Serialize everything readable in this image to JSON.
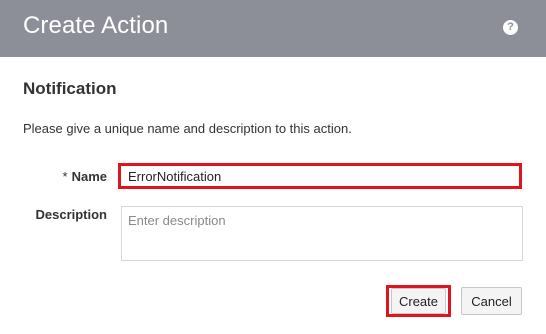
{
  "dialog": {
    "title": "Create Action",
    "help_icon": "?"
  },
  "section": {
    "title": "Notification",
    "instructions": "Please give a unique name and description to this action."
  },
  "form": {
    "name_required_marker": "*",
    "name_label": "Name",
    "name_value": "ErrorNotification",
    "description_label": "Description",
    "description_placeholder": "Enter description"
  },
  "buttons": {
    "create_label": "Create",
    "cancel_label": "Cancel"
  },
  "colors": {
    "header_bg": "#8d8f98",
    "highlight": "#e0141f"
  }
}
